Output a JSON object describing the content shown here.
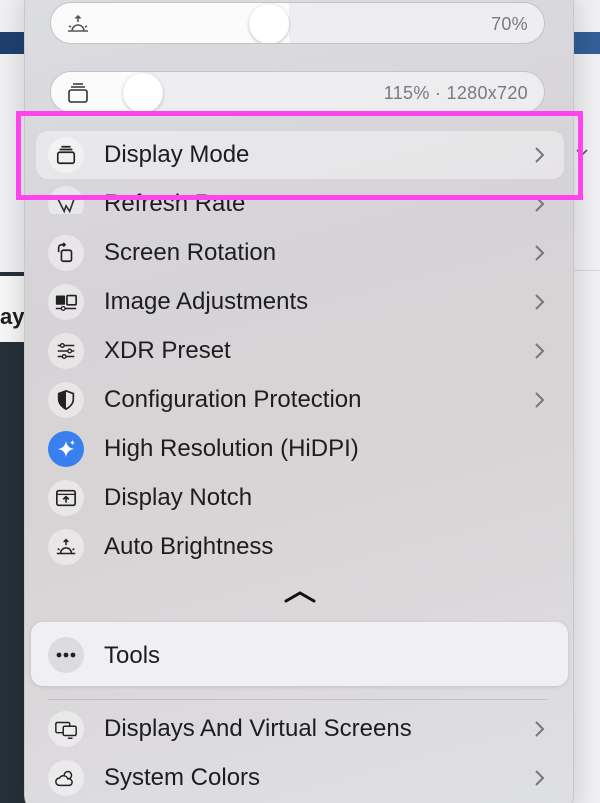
{
  "sliders": {
    "brightness": {
      "value_text": "70%",
      "level": 0.42
    },
    "resolution": {
      "value_text": "115% · 1280x720",
      "level": 0.17
    }
  },
  "menu_items": [
    {
      "label": "Display Mode",
      "icon": "display-mode-icon",
      "submenu": true,
      "selected": true
    },
    {
      "label": "Refresh Rate",
      "icon": "refresh-rate-icon",
      "submenu": true
    },
    {
      "label": "Screen Rotation",
      "icon": "rotation-icon",
      "submenu": true
    },
    {
      "label": "Image Adjustments",
      "icon": "image-adjustments-icon",
      "submenu": true
    },
    {
      "label": "XDR Preset",
      "icon": "sliders-icon",
      "submenu": true
    },
    {
      "label": "Configuration Protection",
      "icon": "shield-icon",
      "submenu": true
    },
    {
      "label": "High Resolution (HiDPI)",
      "icon": "sparkle-icon",
      "submenu": false,
      "active": true
    },
    {
      "label": "Display Notch",
      "icon": "notch-icon",
      "submenu": false
    },
    {
      "label": "Auto Brightness",
      "icon": "sunrise-icon",
      "submenu": false
    }
  ],
  "tools": {
    "label": "Tools",
    "icon": "ellipsis-icon"
  },
  "bottom_items": [
    {
      "label": "Displays And Virtual Screens",
      "icon": "displays-icon",
      "submenu": true
    },
    {
      "label": "System Colors",
      "icon": "weather-icon",
      "submenu": true
    }
  ],
  "background": {
    "cut_text": "ay"
  },
  "colors": {
    "highlight": "#ff44ee",
    "accent": "#3a7ff0"
  }
}
